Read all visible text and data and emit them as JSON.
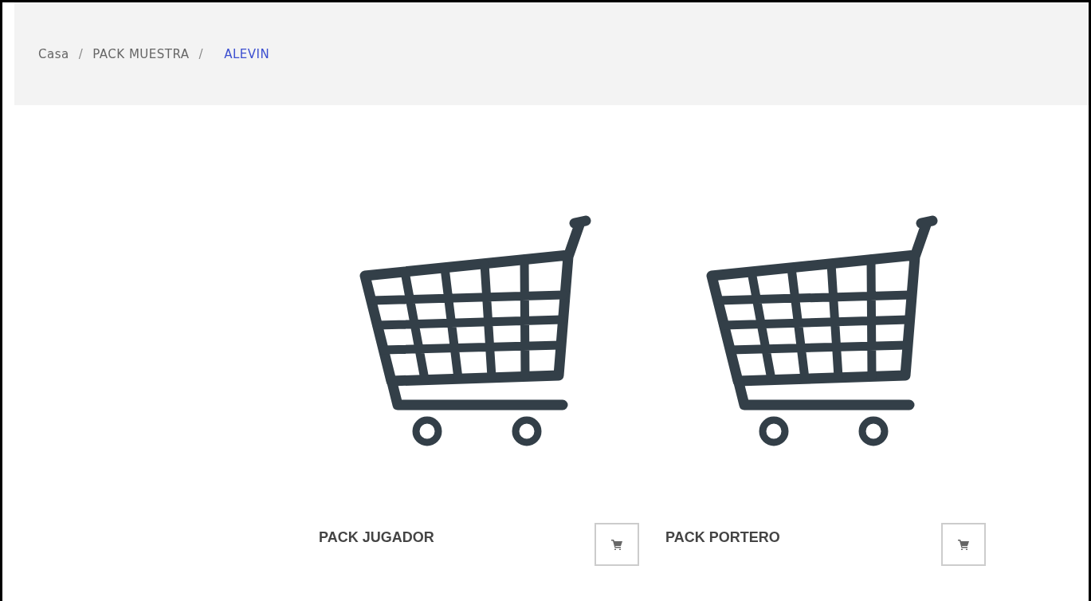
{
  "breadcrumb": [
    {
      "label": "Casa",
      "selected": false
    },
    {
      "label": "PACK MUESTRA",
      "selected": false
    },
    {
      "label": "ALEVIN",
      "selected": true
    }
  ],
  "breadcrumb_separator": "/",
  "products": [
    {
      "title": "PACK JUGADOR"
    },
    {
      "title": "PACK PORTERO"
    }
  ]
}
